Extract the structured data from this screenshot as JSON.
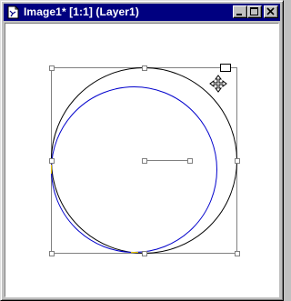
{
  "window": {
    "title": "Image1* [1:1] (Layer1)",
    "title_bar_color": "#000080",
    "title_text_color": "#ffffff"
  },
  "title_buttons": {
    "minimize_icon": "minimize-icon",
    "maximize_icon": "maximize-icon",
    "close_icon": "close-icon"
  },
  "canvas": {
    "background": "#ffffff",
    "outer_circle_color": "#000000",
    "inner_circle_color": "#0000cc",
    "bbox_color": "#808080",
    "handle_color": "#808080",
    "move_cursor_icon": "move-cursor-icon",
    "doc_icon": "document-icon"
  }
}
